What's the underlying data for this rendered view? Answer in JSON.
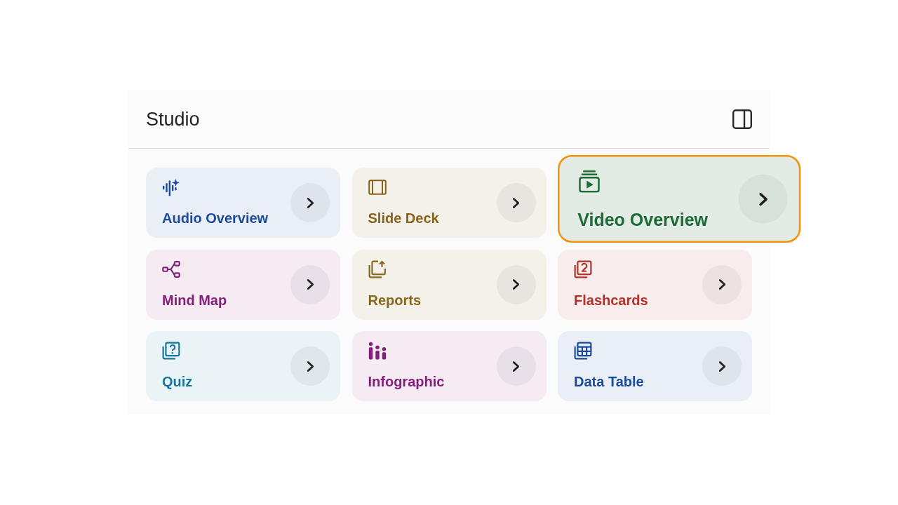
{
  "panel": {
    "title": "Studio"
  },
  "cards": [
    {
      "label": "Audio Overview",
      "color": "#1b4b9f",
      "selected": false
    },
    {
      "label": "Slide Deck",
      "color": "#86621a",
      "selected": false
    },
    {
      "label": "Video Overview",
      "color": "#1e6b37",
      "selected": true
    },
    {
      "label": "Mind Map",
      "color": "#85207a",
      "selected": false
    },
    {
      "label": "Reports",
      "color": "#86681d",
      "selected": false
    },
    {
      "label": "Flashcards",
      "color": "#b0322a",
      "selected": false
    },
    {
      "label": "Quiz",
      "color": "#17789f",
      "selected": false
    },
    {
      "label": "Infographic",
      "color": "#85207a",
      "selected": false
    },
    {
      "label": "Data Table",
      "color": "#1b4b9f",
      "selected": false
    }
  ]
}
